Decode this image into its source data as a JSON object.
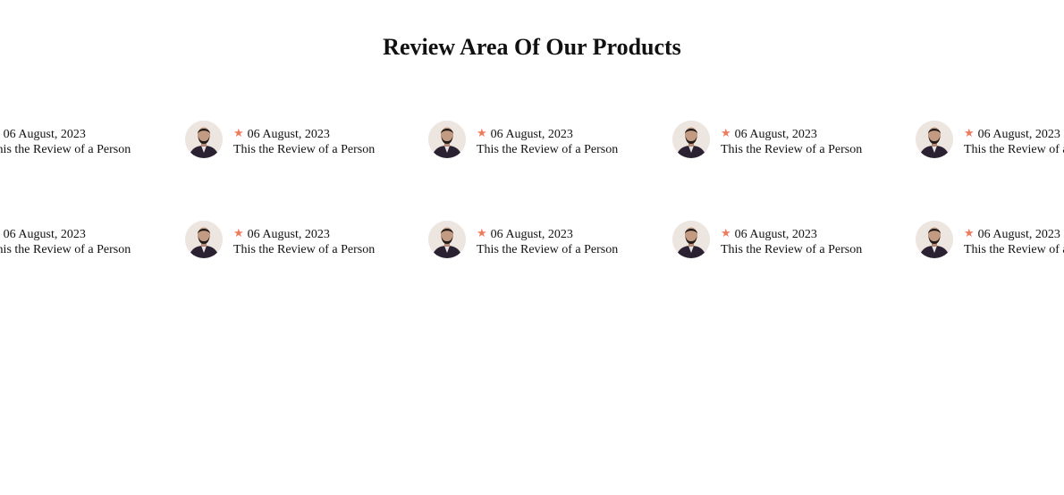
{
  "page": {
    "title": "Review Area Of Our Products"
  },
  "reviews": {
    "row1": [
      {
        "date": "06 August, 2023",
        "text": "This the Review of a Person",
        "rating_icon": "star-icon"
      },
      {
        "date": "06 August, 2023",
        "text": "This the Review of a Person",
        "rating_icon": "star-icon"
      },
      {
        "date": "06 August, 2023",
        "text": "This the Review of a Person",
        "rating_icon": "star-icon"
      },
      {
        "date": "06 August, 2023",
        "text": "This the Review of a Person",
        "rating_icon": "star-icon"
      },
      {
        "date": "06 August, 2023",
        "text": "This the Review of a Person",
        "rating_icon": "star-icon"
      }
    ],
    "row2": [
      {
        "date": "06 August, 2023",
        "text": "This the Review of a Person",
        "rating_icon": "star-icon"
      },
      {
        "date": "06 August, 2023",
        "text": "This the Review of a Person",
        "rating_icon": "star-icon"
      },
      {
        "date": "06 August, 2023",
        "text": "This the Review of a Person",
        "rating_icon": "star-icon"
      },
      {
        "date": "06 August, 2023",
        "text": "This the Review of a Person",
        "rating_icon": "star-icon"
      },
      {
        "date": "06 August, 2023",
        "text": "This the Review of a Person",
        "rating_icon": "star-icon"
      }
    ]
  },
  "colors": {
    "star": "#f0795b",
    "text": "#111111",
    "background": "#ffffff"
  }
}
